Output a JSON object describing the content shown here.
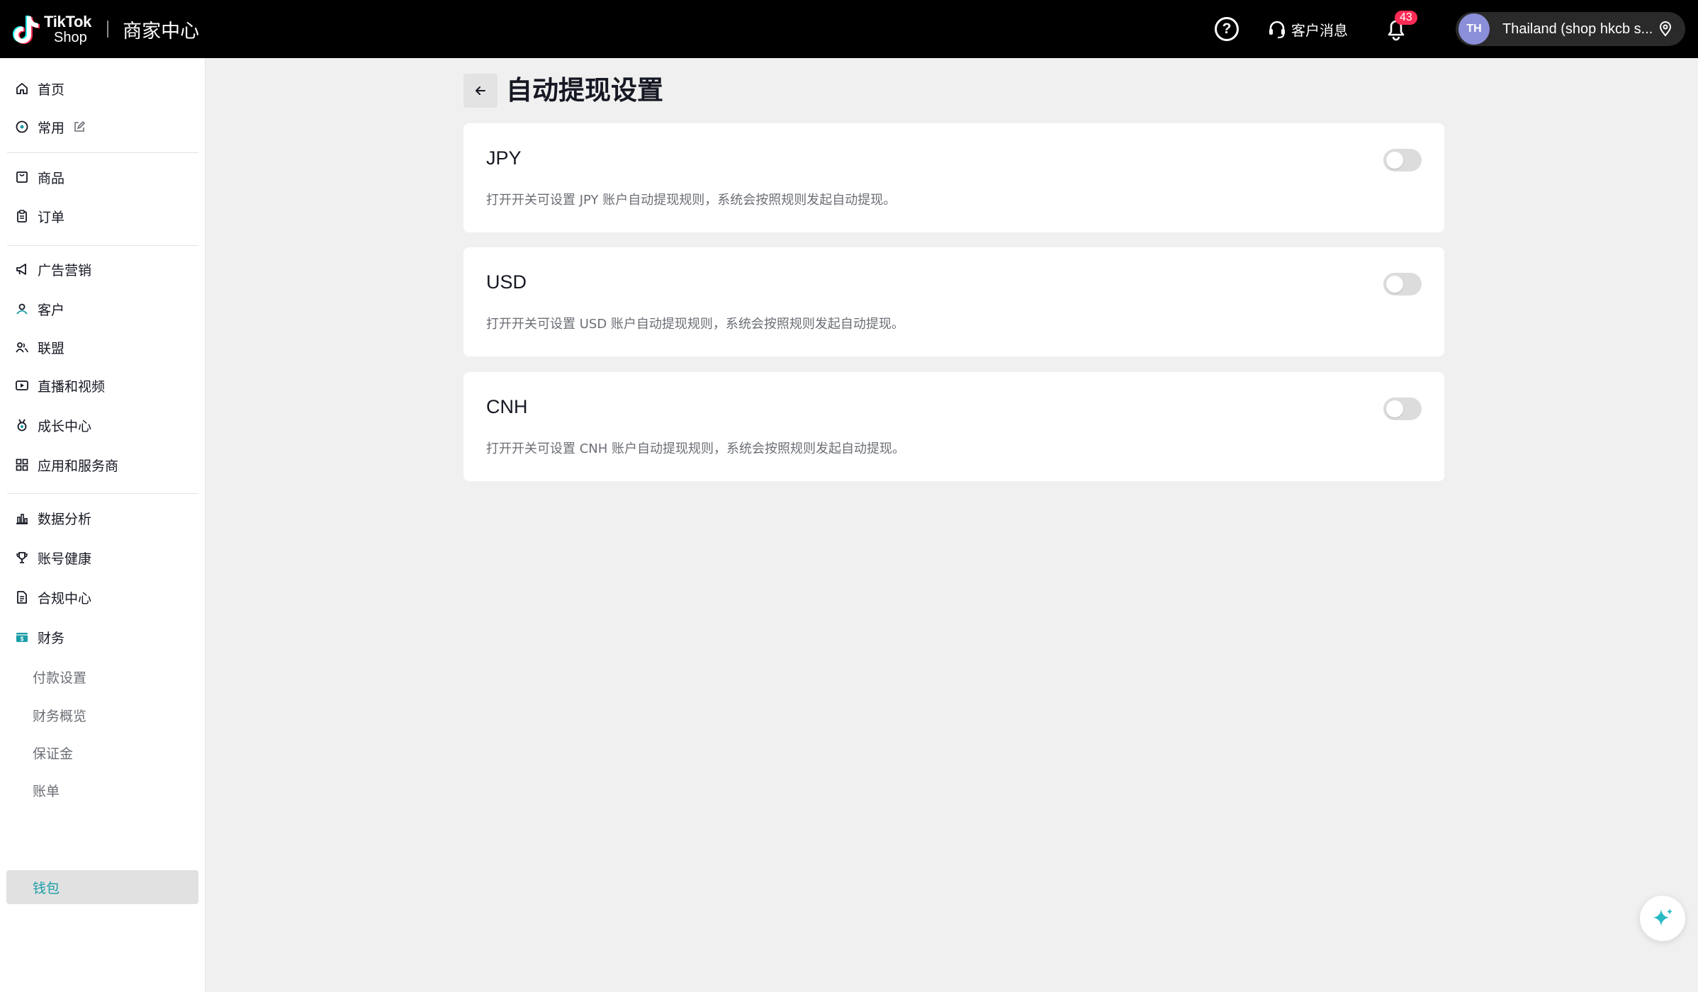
{
  "header": {
    "brand_line1": "TikTok",
    "brand_line2": "Shop",
    "title": "商家中心",
    "help_label": "?",
    "customer_service_label": "客户消息",
    "notification_count": "43",
    "avatar_initials": "TH",
    "shop_name": "Thailand  (shop hkcb s..."
  },
  "sidebar": {
    "items": [
      {
        "label": "首页",
        "icon": "home-icon"
      },
      {
        "label": "常用",
        "icon": "pin-circle-icon"
      },
      {
        "label": "商品",
        "icon": "product-icon"
      },
      {
        "label": "订单",
        "icon": "clipboard-icon"
      },
      {
        "label": "广告营销",
        "icon": "megaphone-icon"
      },
      {
        "label": "客户",
        "icon": "customer-icon"
      },
      {
        "label": "联盟",
        "icon": "users-icon"
      },
      {
        "label": "直播和视频",
        "icon": "video-icon"
      },
      {
        "label": "成长中心",
        "icon": "medal-icon"
      },
      {
        "label": "应用和服务商",
        "icon": "apps-icon"
      },
      {
        "label": "数据分析",
        "icon": "bar-chart-icon"
      },
      {
        "label": "账号健康",
        "icon": "trophy-icon"
      },
      {
        "label": "合规中心",
        "icon": "document-icon"
      },
      {
        "label": "财务",
        "icon": "finance-icon"
      }
    ],
    "finance_sub": [
      "付款设置",
      "财务概览",
      "保证金",
      "账单",
      "钱包"
    ],
    "active_sub": "钱包"
  },
  "main": {
    "title": "自动提现设置",
    "cards": [
      {
        "currency": "JPY",
        "description": "打开开关可设置 JPY 账户自动提现规则，系统会按照规则发起自动提现。",
        "enabled": false
      },
      {
        "currency": "USD",
        "description": "打开开关可设置 USD 账户自动提现规则，系统会按照规则发起自动提现。",
        "enabled": false
      },
      {
        "currency": "CNH",
        "description": "打开开关可设置 CNH 账户自动提现规则，系统会按照规则发起自动提现。",
        "enabled": false
      }
    ]
  },
  "colors": {
    "accent": "#1a9da6",
    "badge": "#fe2c55",
    "avatar": "#8b8fd9"
  }
}
